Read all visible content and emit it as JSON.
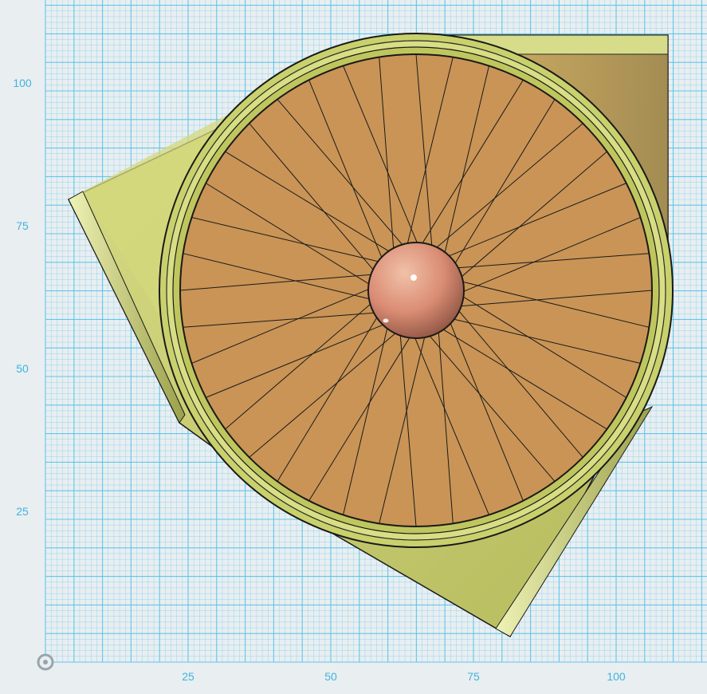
{
  "workplane": {
    "grid_color": "#52c3ec",
    "background": "#e9eef0",
    "x_ticks": [
      "25",
      "50",
      "75",
      "100"
    ],
    "y_ticks": [
      "100",
      "75",
      "50",
      "25"
    ]
  },
  "model": {
    "spoke_count": 40,
    "colors": {
      "base_plate": "#c9cc72",
      "disc": "#c99456",
      "rim": "#c9d16d",
      "hub": "#d98c73",
      "outline": "#1a1a1a"
    }
  },
  "origin_marker": {
    "icon": "origin-circle-icon"
  }
}
